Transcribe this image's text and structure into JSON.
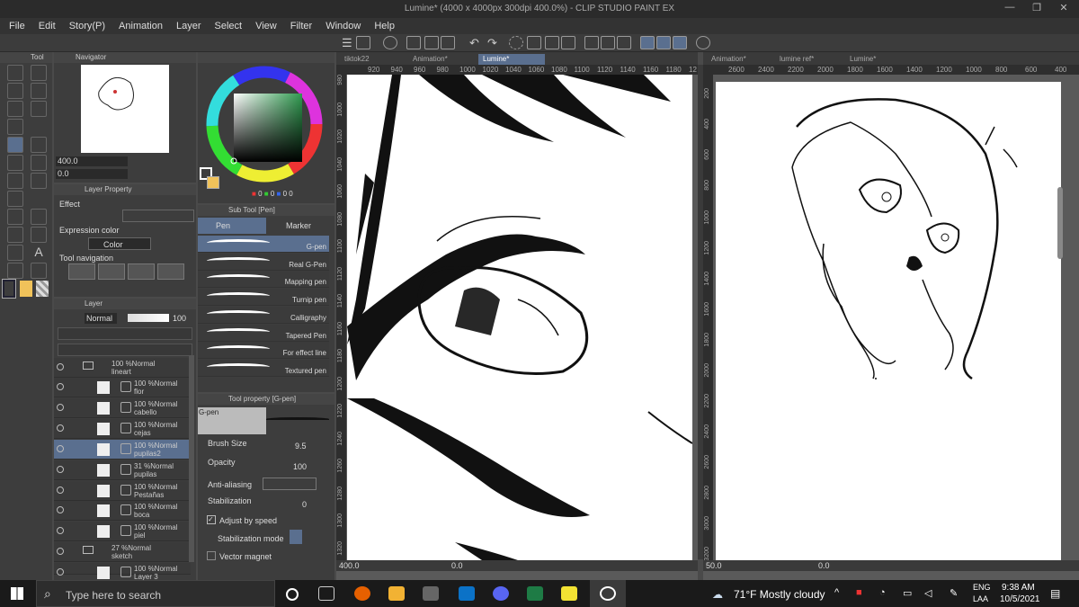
{
  "window": {
    "title": "Lumine* (4000 x 4000px 300dpi 400.0%)  - CLIP STUDIO PAINT EX"
  },
  "menu": [
    "File",
    "Edit",
    "Story(P)",
    "Animation",
    "Layer",
    "Select",
    "View",
    "Filter",
    "Window",
    "Help"
  ],
  "panels": {
    "tool": "Tool",
    "navigator": "Navigator",
    "layer_property": "Layer Property",
    "effect": "Effect",
    "expression_color": "Expression color",
    "color_value": "Color",
    "tool_navigation": "Tool navigation",
    "layer": "Layer",
    "sub_tool": "Sub Tool [Pen]",
    "tool_property": "Tool property [G-pen]"
  },
  "navigator": {
    "zoom": "400.0",
    "angle": "0.0"
  },
  "color": {
    "main": "#0a0c1c",
    "sub": "#f0c25a",
    "r": "0",
    "g": "0",
    "b": "0",
    "v": "0"
  },
  "layer": {
    "blend": "Normal",
    "opacity": "100"
  },
  "layers": [
    {
      "pct": "100 %Normal",
      "name": "lineart"
    },
    {
      "pct": "100 %Normal",
      "name": "flor"
    },
    {
      "pct": "100 %Normal",
      "name": "cabello"
    },
    {
      "pct": "100 %Normal",
      "name": "cejas"
    },
    {
      "pct": "100 %Normal",
      "name": "pupilas2"
    },
    {
      "pct": "31 %Normal",
      "name": "pupilas"
    },
    {
      "pct": "100 %Normal",
      "name": "Pestañas"
    },
    {
      "pct": "100 %Normal",
      "name": "boca"
    },
    {
      "pct": "100 %Normal",
      "name": "piel"
    },
    {
      "pct": "27 %Normal",
      "name": "sketch"
    },
    {
      "pct": "100 %Normal",
      "name": "Layer 3"
    }
  ],
  "subtool": {
    "tab_pen": "Pen",
    "tab_marker": "Marker",
    "brushes": [
      "G-pen",
      "Real G-Pen",
      "Mapping pen",
      "Turnip pen",
      "Calligraphy",
      "Tapered Pen",
      "For effect line",
      "Textured pen"
    ]
  },
  "toolprop": {
    "name": "G-pen",
    "brush_size_label": "Brush Size",
    "brush_size": "9.5",
    "opacity_label": "Opacity",
    "opacity": "100",
    "aa_label": "Anti-aliasing",
    "stab_label": "Stabilization",
    "stab": "0",
    "adjust": "Adjust by speed",
    "stab_mode": "Stabilization mode",
    "vector": "Vector magnet"
  },
  "canvas1": {
    "tabs": [
      "tiktok22",
      "Animation*",
      "Lumine*"
    ],
    "ruler": [
      "920",
      "940",
      "960",
      "980",
      "1000",
      "1020",
      "1040",
      "1060",
      "1080",
      "1100",
      "1120",
      "1140",
      "1160",
      "1180",
      "12"
    ],
    "vruler": [
      "980",
      "1000",
      "1020",
      "1040",
      "1060",
      "1080",
      "1100",
      "1120",
      "1140",
      "1160",
      "1180",
      "1200",
      "1220",
      "1240",
      "1260",
      "1280",
      "1300",
      "1320"
    ],
    "zoom": "400.0",
    "angle": "0.0"
  },
  "canvas2": {
    "tabs": [
      "Animation*",
      "lumine ref*",
      "Lumine*"
    ],
    "ruler": [
      "2600",
      "2400",
      "2200",
      "2000",
      "1800",
      "1600",
      "1400",
      "1200",
      "1000",
      "800",
      "600",
      "400"
    ],
    "vruler": [
      "200",
      "400",
      "600",
      "800",
      "1000",
      "1200",
      "1400",
      "1600",
      "1800",
      "2000",
      "2200",
      "2400",
      "2600",
      "2800",
      "3000",
      "3200"
    ],
    "zoom": "50.0",
    "angle": "0.0"
  },
  "taskbar": {
    "search": "Type here to search",
    "weather": "71°F  Mostly cloudy",
    "lang1": "ENG",
    "lang2": "LAA",
    "time": "9:38 AM",
    "date": "10/5/2021"
  }
}
